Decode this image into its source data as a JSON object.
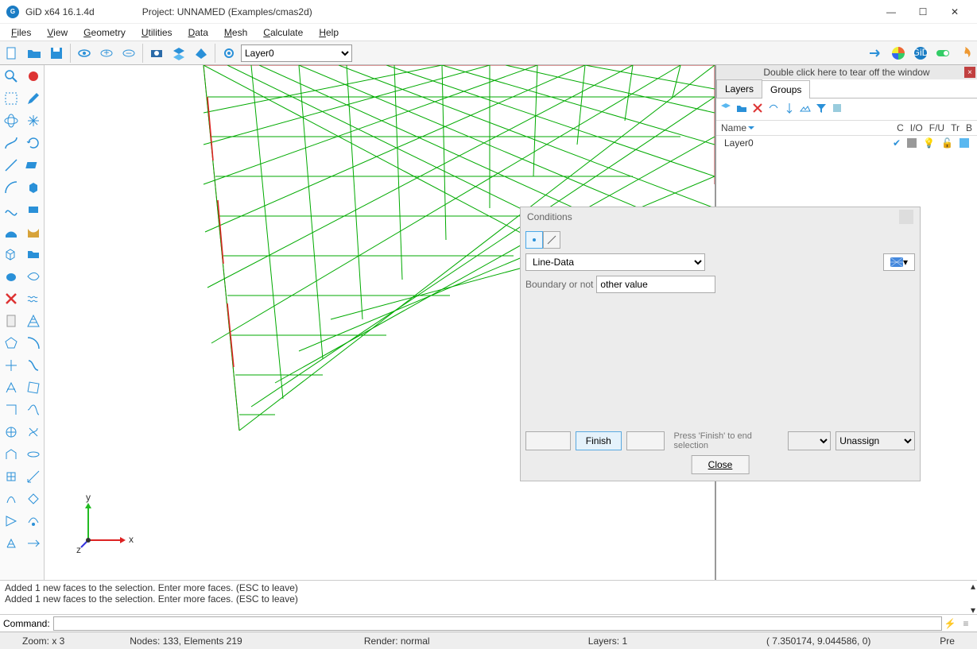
{
  "title": {
    "app": "GiD x64 16.1.4d",
    "project": "Project: UNNAMED (Examples/cmas2d)"
  },
  "menu": [
    "Files",
    "View",
    "Geometry",
    "Utilities",
    "Data",
    "Mesh",
    "Calculate",
    "Help"
  ],
  "layer_selected": "Layer0",
  "rightpanel": {
    "tear_hint": "Double click here to tear off the window",
    "tabs": {
      "layers": "Layers",
      "groups": "Groups"
    },
    "cols": {
      "name": "Name",
      "c": "C",
      "io": "I/O",
      "fu": "F/U",
      "tr": "Tr",
      "b": "B"
    },
    "row": {
      "name": "Layer0"
    }
  },
  "dlg": {
    "title": "Conditions",
    "type_select": "Line-Data",
    "bn_label": "Boundary or not",
    "bn_value": "other value",
    "finish": "Finish",
    "hint": "Press 'Finish' to end selection",
    "unassign": "Unassign",
    "close": "Close"
  },
  "log": {
    "l1": "Added 1 new  faces to the selection. Enter more faces. (ESC to leave)",
    "l2": "Added 1 new  faces to the selection. Enter more faces. (ESC to leave)"
  },
  "command_label": "Command:",
  "status": {
    "zoom": "Zoom: x 3",
    "nodes": "Nodes: 133, Elements 219",
    "render": "Render: normal",
    "layers": "Layers: 1",
    "coord": "( 7.350174,  9.044586,  0)",
    "mode": "Pre"
  }
}
